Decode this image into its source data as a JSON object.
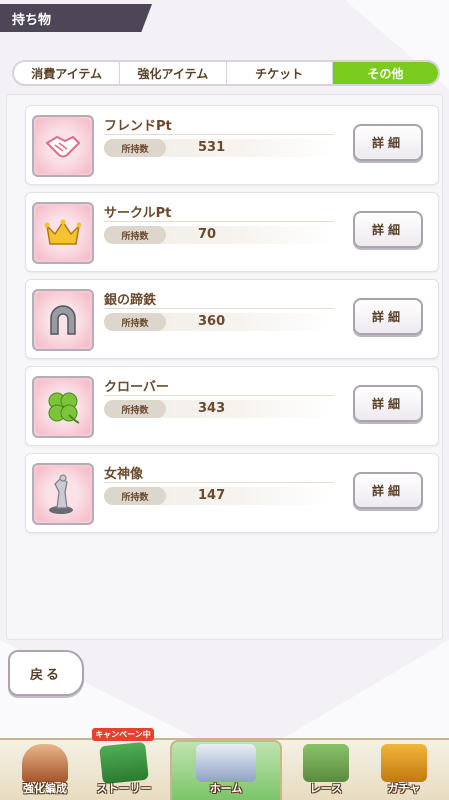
{
  "header": {
    "title": "持ち物"
  },
  "tabs": [
    {
      "label": "消費アイテム",
      "active": false
    },
    {
      "label": "強化アイテム",
      "active": false
    },
    {
      "label": "チケット",
      "active": false
    },
    {
      "label": "その他",
      "active": true
    }
  ],
  "items": [
    {
      "name": "フレンドPt",
      "qty_label": "所持数",
      "qty": "531",
      "detail_label": "詳細",
      "icon": "handshake-icon"
    },
    {
      "name": "サークルPt",
      "qty_label": "所持数",
      "qty": "70",
      "detail_label": "詳細",
      "icon": "crown-icon"
    },
    {
      "name": "銀の蹄鉄",
      "qty_label": "所持数",
      "qty": "360",
      "detail_label": "詳細",
      "icon": "horseshoe-icon"
    },
    {
      "name": "クローバー",
      "qty_label": "所持数",
      "qty": "343",
      "detail_label": "詳細",
      "icon": "clover-icon"
    },
    {
      "name": "女神像",
      "qty_label": "所持数",
      "qty": "147",
      "detail_label": "詳細",
      "icon": "statue-icon"
    }
  ],
  "back_label": "戻る",
  "nav": {
    "items": [
      {
        "label": "強化編成",
        "icon": "character-icon"
      },
      {
        "label": "ストーリー",
        "icon": "story-book-icon",
        "badge": "キャンペーン中"
      },
      {
        "label": "ホーム",
        "icon": "home-building-icon"
      },
      {
        "label": "レース",
        "icon": "race-gate-icon"
      },
      {
        "label": "ガチャ",
        "icon": "gacha-door-icon"
      }
    ]
  },
  "colors": {
    "active_tab": "#7bcb1f",
    "header_bg": "#4c4657",
    "icon_bg": "#f7c9d4"
  }
}
